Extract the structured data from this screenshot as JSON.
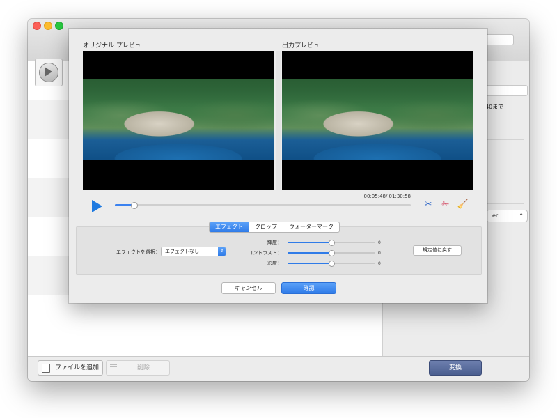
{
  "preview": {
    "original_label": "オリジナル プレビュー",
    "output_label": "出力プレビュー"
  },
  "playback": {
    "timecode": "00:05:48/ 01:30:58",
    "progress": 0.064
  },
  "tabs": [
    {
      "label": "エフェクト",
      "active": true
    },
    {
      "label": "クロップ",
      "active": false
    },
    {
      "label": "ウォーターマーク",
      "active": false
    }
  ],
  "effects": {
    "select_label": "エフェクトを選択：",
    "select_value": "エフェクトなし",
    "brightness_label": "輝度：",
    "brightness_value": "0",
    "contrast_label": "コントラスト：",
    "contrast_value": "0",
    "saturation_label": "彩度：",
    "saturation_value": "0",
    "slider_position": 0.5,
    "reset_label": "規定値に戻す"
  },
  "dialog": {
    "cancel_label": "キャンセル",
    "ok_label": "確認"
  },
  "main_window": {
    "add_file_label": "ファイルを追加",
    "delete_label": "削除",
    "convert_label": "変換",
    "right_pane_text": "40まで",
    "right_pane_select": "er"
  },
  "colors": {
    "accent": "#2f7be8",
    "convert_button": "#4b5f90",
    "play_icon": "#1e7ae0"
  },
  "icons": {
    "play": "play-icon",
    "cut_filmstrip": "film-cut-icon",
    "scissors": "scissors-icon",
    "clean_brush": "broom-icon"
  }
}
